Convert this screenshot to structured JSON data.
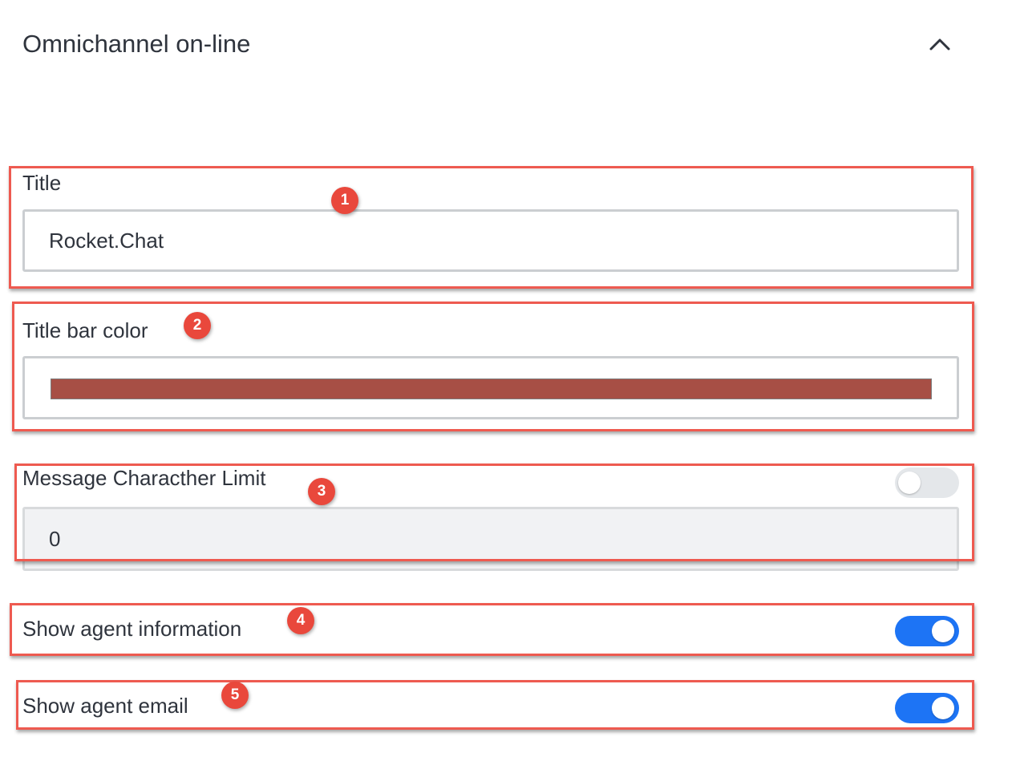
{
  "section": {
    "title": "Omnichannel on-line",
    "collapse_icon": "chevron-up-icon"
  },
  "fields": {
    "title": {
      "label": "Title",
      "value": "Rocket.Chat"
    },
    "title_bar_color": {
      "label": "Title bar color",
      "color": "#a74f45"
    },
    "message_limit": {
      "label": "Message Characther Limit",
      "value": "0",
      "toggle_on": false
    },
    "show_agent_info": {
      "label": "Show agent information",
      "toggle_on": true
    },
    "show_agent_email": {
      "label": "Show agent email",
      "toggle_on": true
    }
  },
  "annotations": [
    "1",
    "2",
    "3",
    "4",
    "5"
  ],
  "colors": {
    "accent": "#1d74f5",
    "highlight": "#ee5a50",
    "badge": "#e9483c"
  }
}
